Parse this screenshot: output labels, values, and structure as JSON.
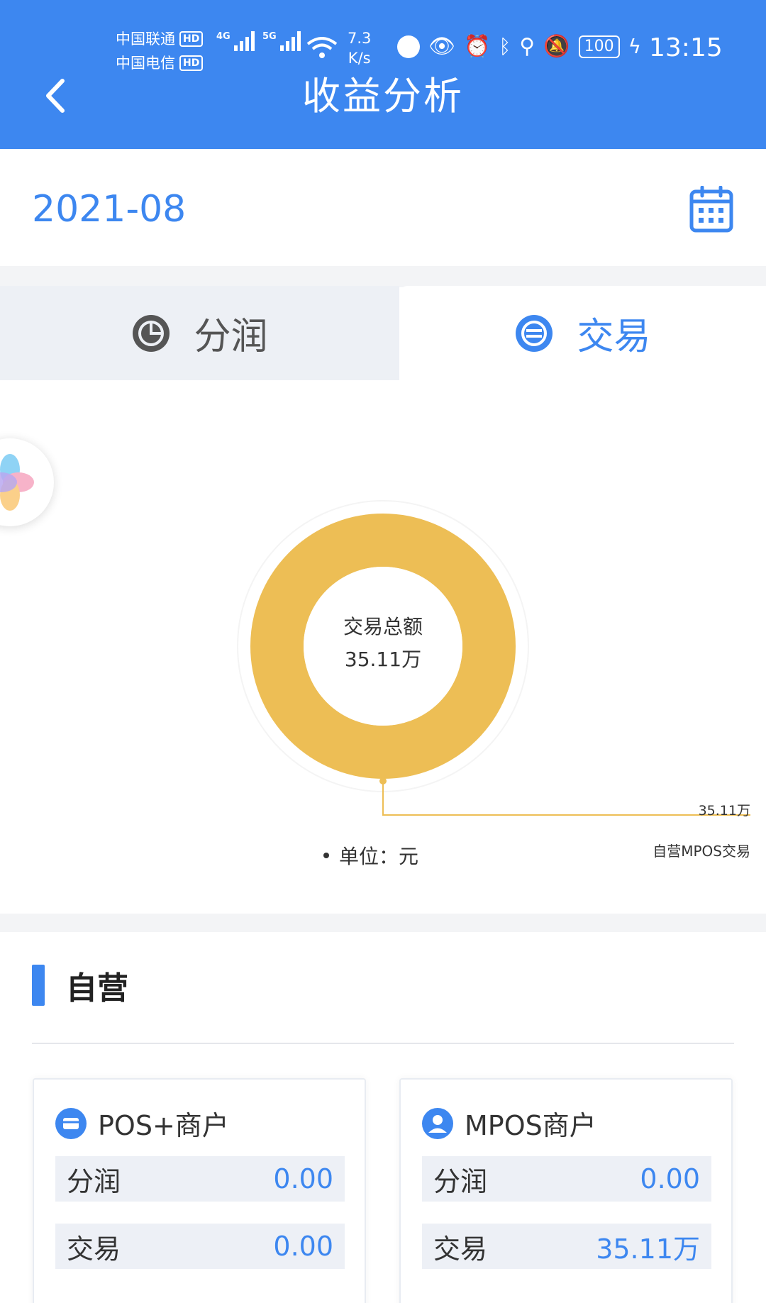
{
  "status_bar": {
    "carrier1": "中国联通",
    "carrier2": "中国电信",
    "hd": "HD",
    "sig1_label": "4G",
    "sig2_label": "5G",
    "speed_value": "7.3",
    "speed_unit": "K/s",
    "battery": "100",
    "time": "13:15"
  },
  "header": {
    "title": "收益分析"
  },
  "date": {
    "value": "2021-08"
  },
  "tabs": [
    {
      "label": "分润",
      "active": false
    },
    {
      "label": "交易",
      "active": true
    }
  ],
  "chart_data": {
    "type": "pie",
    "donut": true,
    "center_title": "交易总额",
    "center_value": "35.11万",
    "slices": [
      {
        "label": "自营MPOS交易",
        "value_text": "35.11万",
        "value": 351100,
        "color": "#edbe55"
      }
    ],
    "unit_text": "单位：元"
  },
  "section": {
    "title": "自营"
  },
  "cards": [
    {
      "title": "POS+商户",
      "icon": "card-icon",
      "rows": [
        {
          "label": "分润",
          "value": "0.00"
        },
        {
          "label": "交易",
          "value": "0.00"
        }
      ]
    },
    {
      "title": "MPOS商户",
      "icon": "user-icon",
      "rows": [
        {
          "label": "分润",
          "value": "0.00"
        },
        {
          "label": "交易",
          "value": "35.11万"
        }
      ]
    }
  ],
  "colors": {
    "primary": "#3d87f0",
    "donut": "#edbe55"
  }
}
